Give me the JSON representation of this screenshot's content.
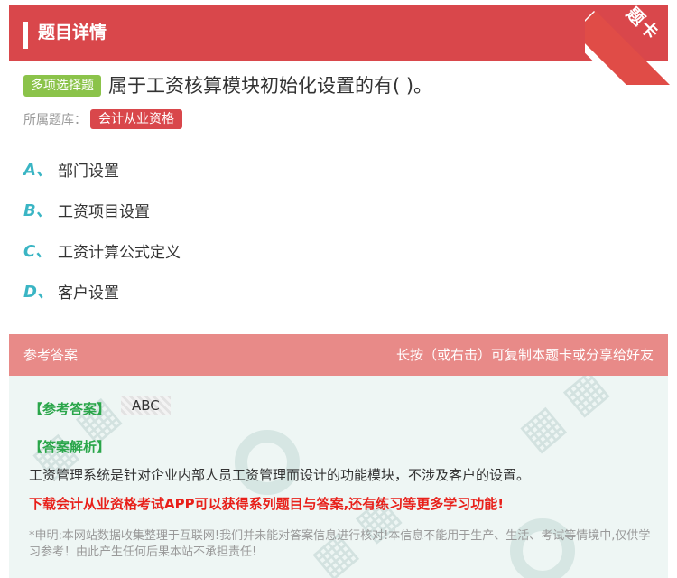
{
  "header": {
    "title": "题目详情",
    "ribbon": "题卡"
  },
  "question": {
    "type_badge": "多项选择题",
    "text": "属于工资核算模块初始化设置的有( )。",
    "bank_label": "所属题库：",
    "bank_name": "会计从业资格"
  },
  "options": [
    {
      "letter": "A、",
      "text": "部门设置"
    },
    {
      "letter": "B、",
      "text": "工资项目设置"
    },
    {
      "letter": "C、",
      "text": "工资计算公式定义"
    },
    {
      "letter": "D、",
      "text": "客户设置"
    }
  ],
  "answer": {
    "section_title": "参考答案",
    "hint": "长按（或右击）可复制本题卡或分享给好友",
    "answer_label": "【参考答案】",
    "answer_value": "ABC",
    "analysis_label": "【答案解析】",
    "analysis_text": "工资管理系统是针对企业内部人员工资管理而设计的功能模块，不涉及客户的设置。",
    "promo": "下载会计从业资格考试APP可以获得系列题目与答案,还有练习等更多学习功能!",
    "disclaimer": "*申明:本网站数据收集整理于互联网!我们并未能对答案信息进行核对!本信息不能用于生产、生活、考试等情境中,仅供学习参考！由此产生任何后果本站不承担责任!"
  },
  "colors": {
    "header_red": "#d9474b",
    "type_green": "#8bc34a",
    "option_teal": "#3ab5c4",
    "answer_green": "#2aa64a",
    "promo_red": "#e8201a"
  }
}
